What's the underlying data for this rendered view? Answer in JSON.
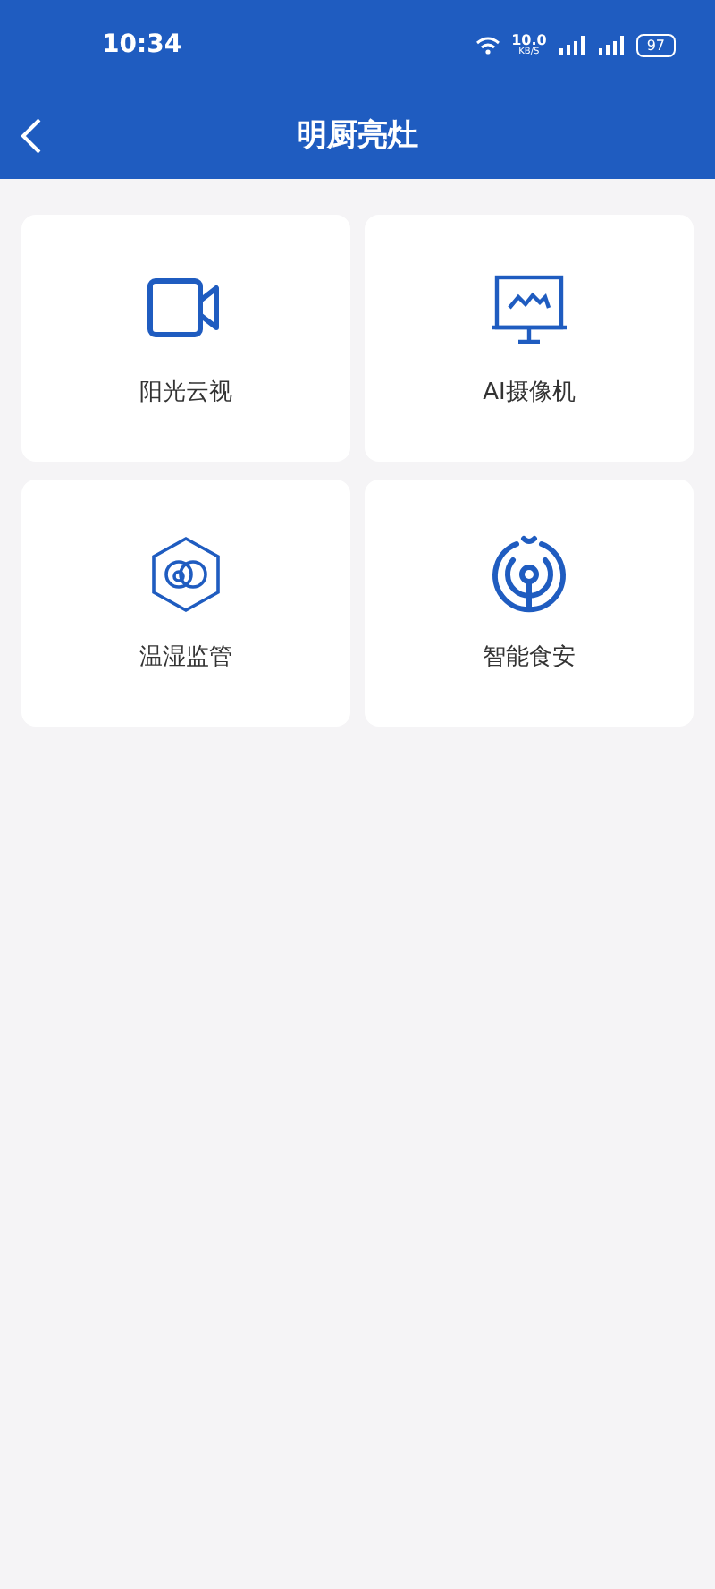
{
  "status_bar": {
    "time": "10:34",
    "net_speed": "10.0",
    "net_unit": "KB/S",
    "battery": "97"
  },
  "nav": {
    "title": "明厨亮灶"
  },
  "tiles": [
    {
      "kind": "video",
      "label": "阳光云视"
    },
    {
      "kind": "monitor",
      "label": "AI摄像机"
    },
    {
      "kind": "hexagon",
      "label": "温湿监管"
    },
    {
      "kind": "signal",
      "label": "智能食安"
    }
  ]
}
